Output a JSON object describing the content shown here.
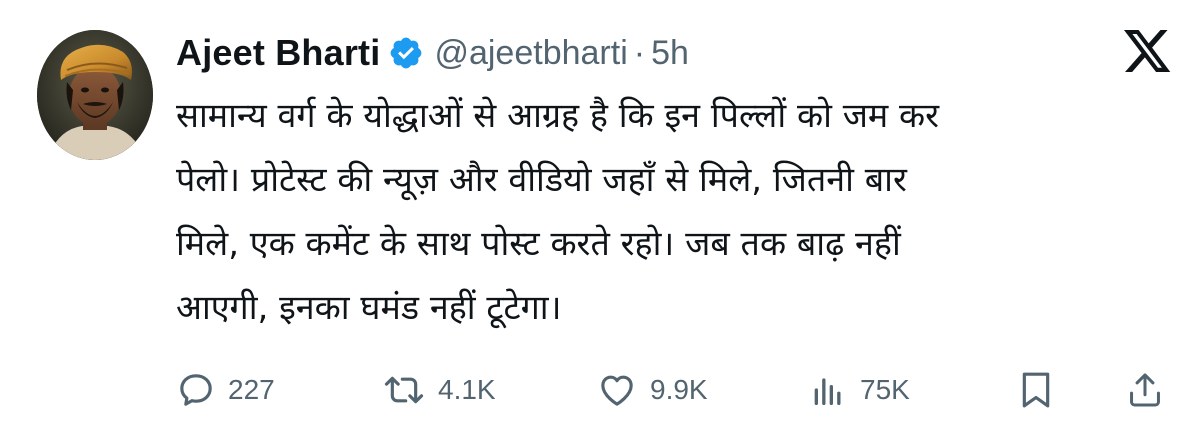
{
  "author": {
    "name": "Ajeet Bharti",
    "handle": "@ajeetbharti",
    "separator": "·",
    "time": "5h",
    "verified_color": "#1d9bf0"
  },
  "platform_icon": "x-logo-icon",
  "tweet": {
    "lines": [
      "सामान्य वर्ग के योद्धाओं से आग्रह है कि इन पिल्लों को जम कर",
      "पेलो। प्रोटेस्ट की न्यूज़ और वीडियो जहाँ से मिले, जितनी बार",
      "मिले, एक कमेंट के साथ पोस्ट करते रहो। जब तक बाढ़ नहीं",
      "आएगी, इनका घमंड नहीं टूटेगा।"
    ]
  },
  "actions": {
    "replies": {
      "icon": "reply-icon",
      "count": "227"
    },
    "reposts": {
      "icon": "repost-icon",
      "count": "4.1K"
    },
    "likes": {
      "icon": "heart-icon",
      "count": "9.9K"
    },
    "views": {
      "icon": "views-icon",
      "count": "75K"
    },
    "bookmark": {
      "icon": "bookmark-icon"
    },
    "share": {
      "icon": "share-icon"
    }
  },
  "colors": {
    "text": "#0f1419",
    "secondary": "#536471",
    "verified": "#1d9bf0"
  }
}
